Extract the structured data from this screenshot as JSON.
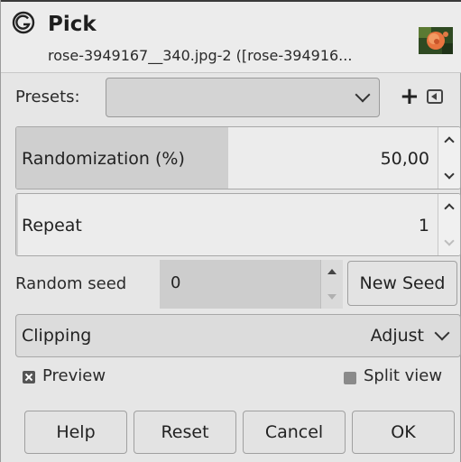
{
  "header": {
    "title": "Pick",
    "subtitle": "rose-3949167__340.jpg-2 ([rose-394916..."
  },
  "presets": {
    "label": "Presets:",
    "value": ""
  },
  "randomization": {
    "label": "Randomization (%)",
    "value": "50,00",
    "fraction": 0.5
  },
  "repeat": {
    "label": "Repeat",
    "value": "1"
  },
  "random_seed": {
    "label": "Random seed",
    "value": "0",
    "new_seed_button": "New Seed"
  },
  "clipping": {
    "label": "Clipping",
    "value": "Adjust"
  },
  "preview": {
    "label": "Preview",
    "checked": true
  },
  "split_view": {
    "label": "Split view",
    "checked": false
  },
  "buttons": {
    "help": "Help",
    "reset": "Reset",
    "cancel": "Cancel",
    "ok": "OK"
  },
  "icons": {
    "logo": "gimp-logo-icon",
    "thumbnail": "rose-thumbnail-image",
    "add": "plus-icon",
    "menu": "preset-menu-icon"
  }
}
